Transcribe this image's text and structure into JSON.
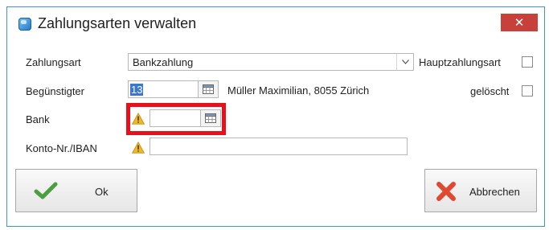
{
  "window": {
    "title": "Zahlungsarten verwalten",
    "close_glyph": "✕",
    "app_icon": "app-icon"
  },
  "form": {
    "zahlungsart": {
      "label": "Zahlungsart",
      "value": "Bankzahlung"
    },
    "beguenstigter": {
      "label": "Begünstigter",
      "code": "13",
      "name": "Müller Maximilian, 8055 Zürich"
    },
    "bank": {
      "label": "Bank",
      "value": ""
    },
    "konto": {
      "label": "Konto-Nr./IBAN",
      "value": ""
    },
    "hauptzahlungsart": {
      "label": "Hauptzahlungsart",
      "checked": false
    },
    "geloescht": {
      "label": "gelöscht",
      "checked": false
    }
  },
  "buttons": {
    "ok": "Ok",
    "abbrechen": "Abbrechen"
  },
  "colors": {
    "accent": "#4a8fd6",
    "close": "#c7413a",
    "highlight": "#e8101b",
    "ok_check": "#4aa03f",
    "cancel_x": "#e0482f",
    "warning": "#f2b820"
  }
}
